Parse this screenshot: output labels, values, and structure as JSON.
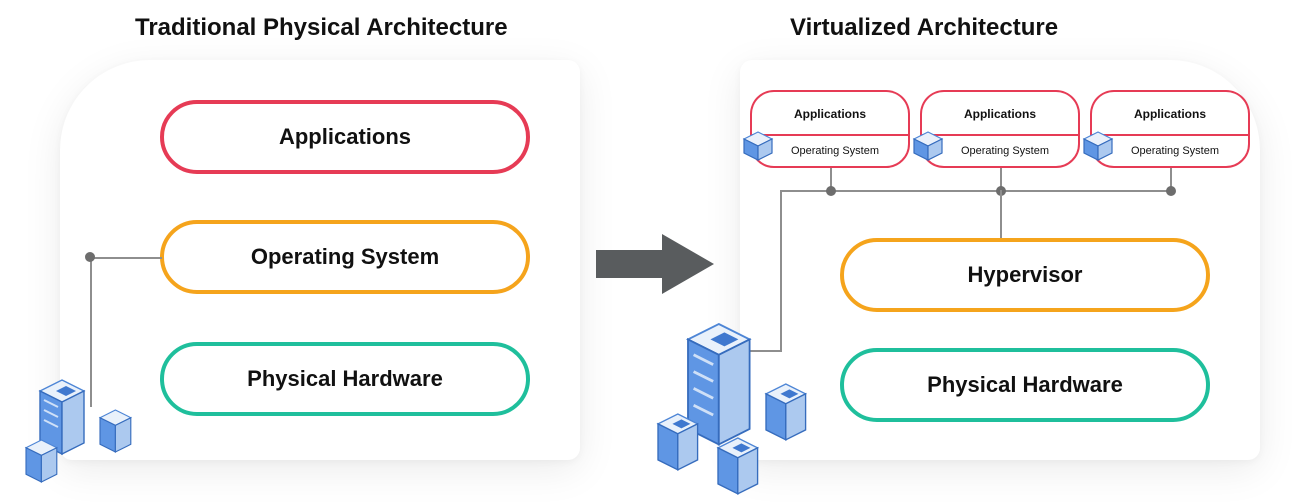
{
  "titles": {
    "left": "Traditional Physical Architecture",
    "right": "Virtualized Architecture"
  },
  "left": {
    "layers": {
      "applications": "Applications",
      "os": "Operating System",
      "hardware": "Physical Hardware"
    }
  },
  "right": {
    "vms": [
      {
        "app": "Applications",
        "os": "Operating System"
      },
      {
        "app": "Applications",
        "os": "Operating System"
      },
      {
        "app": "Applications",
        "os": "Operating System"
      }
    ],
    "layers": {
      "hypervisor": "Hypervisor",
      "hardware": "Physical Hardware"
    }
  },
  "colors": {
    "red": "#e63b55",
    "orange": "#f5a41c",
    "teal": "#1fbf9c",
    "arrow": "#595c5e",
    "connector": "#8e8e8e"
  }
}
